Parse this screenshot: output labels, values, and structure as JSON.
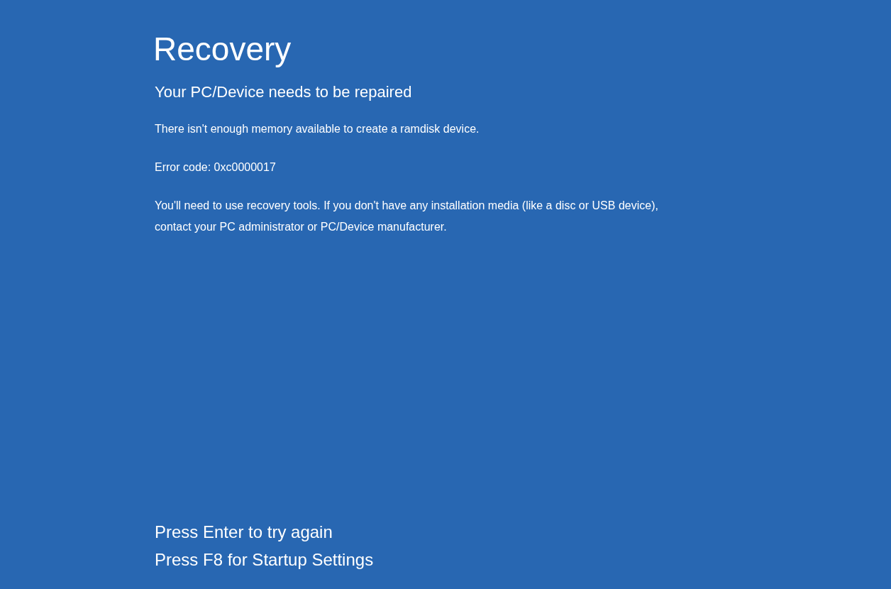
{
  "title": "Recovery",
  "subtitle": "Your PC/Device needs to be repaired",
  "paragraphs": [
    "There isn't enough memory available to create a ramdisk device.",
    "Error code: 0xc0000017",
    "You'll need to use recovery tools. If you don't have any installation media (like a disc or USB device), contact your PC administrator or PC/Device manufacturer."
  ],
  "actions": [
    "Press Enter to try again",
    "Press F8 for Startup Settings"
  ]
}
